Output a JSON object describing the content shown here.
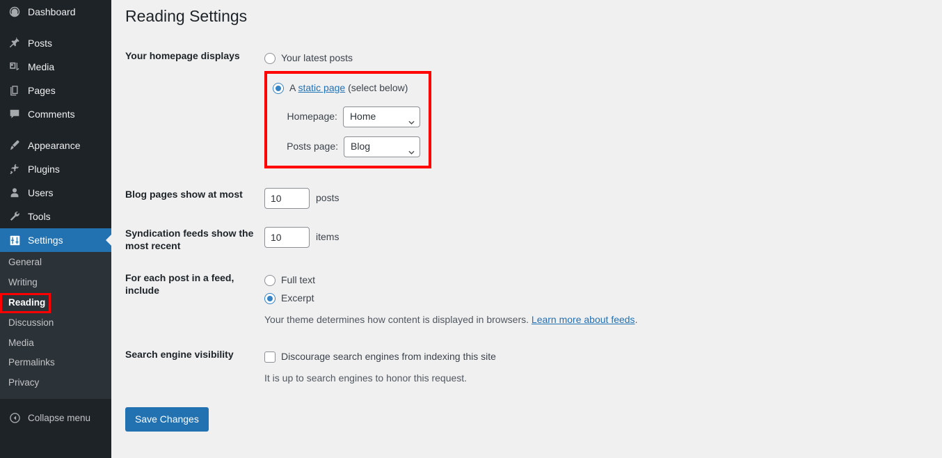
{
  "colors": {
    "sidebar_bg": "#1d2327",
    "submenu_bg": "#2c3338",
    "accent_blue": "#2271b1",
    "link_blue": "#2271b1",
    "radio_blue": "#3582c4",
    "annotation_red": "#fe0000",
    "content_bg": "#f0f0f1"
  },
  "sidebar": {
    "items": [
      {
        "label": "Dashboard",
        "icon": "dashboard-icon",
        "current": false
      },
      {
        "label": "Posts",
        "icon": "pin-icon",
        "current": false
      },
      {
        "label": "Media",
        "icon": "media-icon",
        "current": false
      },
      {
        "label": "Pages",
        "icon": "pages-icon",
        "current": false
      },
      {
        "label": "Comments",
        "icon": "comments-icon",
        "current": false
      },
      {
        "label": "Appearance",
        "icon": "brush-icon",
        "current": false
      },
      {
        "label": "Plugins",
        "icon": "plugin-icon",
        "current": false
      },
      {
        "label": "Users",
        "icon": "user-icon",
        "current": false
      },
      {
        "label": "Tools",
        "icon": "wrench-icon",
        "current": false
      },
      {
        "label": "Settings",
        "icon": "settings-sliders-icon",
        "current": true
      }
    ],
    "submenu": [
      {
        "label": "General",
        "current": false,
        "annotated": false
      },
      {
        "label": "Writing",
        "current": false,
        "annotated": false
      },
      {
        "label": "Reading",
        "current": true,
        "annotated": true
      },
      {
        "label": "Discussion",
        "current": false,
        "annotated": false
      },
      {
        "label": "Media",
        "current": false,
        "annotated": false
      },
      {
        "label": "Permalinks",
        "current": false,
        "annotated": false
      },
      {
        "label": "Privacy",
        "current": false,
        "annotated": false
      }
    ],
    "collapse_label": "Collapse menu",
    "collapse_icon": "chevron-left-circle-icon"
  },
  "page": {
    "title": "Reading Settings"
  },
  "form": {
    "homepage_displays": {
      "label": "Your homepage displays",
      "option_latest": "Your latest posts",
      "option_static_prefix": "A ",
      "option_static_link": "static page",
      "option_static_suffix": " (select below)",
      "selected": "static_page",
      "homepage_label": "Homepage:",
      "homepage_value": "Home",
      "posts_page_label": "Posts page:",
      "posts_page_value": "Blog",
      "annotated": true
    },
    "blog_pages": {
      "label": "Blog pages show at most",
      "value": "10",
      "unit": "posts"
    },
    "syndication_feeds": {
      "label": "Syndication feeds show the most recent",
      "value": "10",
      "unit": "items"
    },
    "feed_include": {
      "label": "For each post in a feed, include",
      "option_full": "Full text",
      "option_excerpt": "Excerpt",
      "selected": "excerpt",
      "description_prefix": "Your theme determines how content is displayed in browsers. ",
      "description_link": "Learn more about feeds",
      "description_suffix": "."
    },
    "search_visibility": {
      "label": "Search engine visibility",
      "checkbox_label": "Discourage search engines from indexing this site",
      "checked": false,
      "description": "It is up to search engines to honor this request."
    },
    "submit_label": "Save Changes"
  }
}
